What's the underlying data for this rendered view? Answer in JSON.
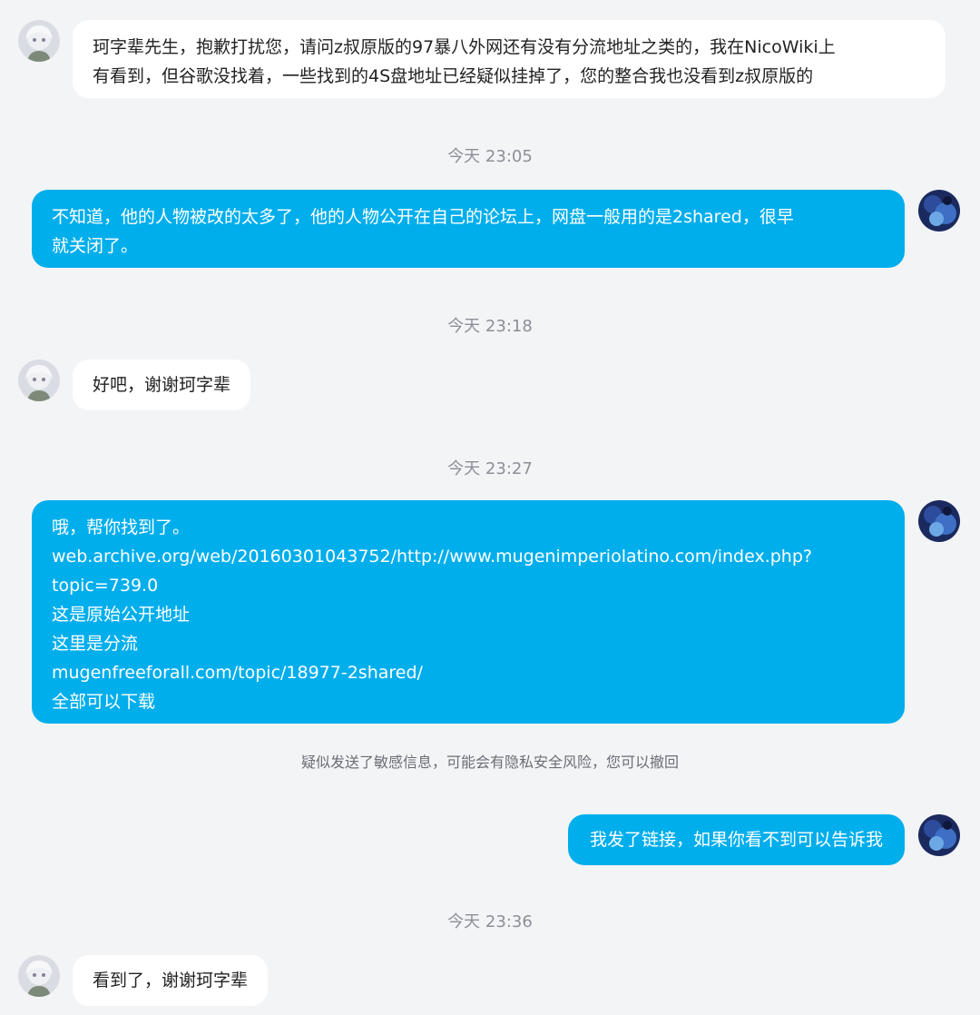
{
  "theme": {
    "background": "#f3f4f6",
    "incoming_bubble": "#ffffff",
    "outgoing_bubble": "#00aeec",
    "timestamp_color": "#8b8f96"
  },
  "messages": [
    {
      "side": "left",
      "avatar": "anime-girl-avatar-icon",
      "text": "珂字辈先生，抱歉打扰您，请问z叔原版的97暴八外网还有没有分流地址之类的，我在NicoWiki上\n有看到，但谷歌没找着，一些找到的4S盘地址已经疑似挂掉了，您的整合我也没看到z叔原版的"
    },
    {
      "timestamp": "今天 23:05"
    },
    {
      "side": "right",
      "avatar": "dark-blue-avatar-icon",
      "text": "不知道，他的人物被改的太多了，他的人物公开在自己的论坛上，网盘一般用的是2shared，很早\n就关闭了。"
    },
    {
      "timestamp": "今天 23:18"
    },
    {
      "side": "left",
      "avatar": "anime-girl-avatar-icon",
      "text": "好吧，谢谢珂字辈"
    },
    {
      "timestamp": "今天 23:27"
    },
    {
      "side": "right",
      "avatar": "dark-blue-avatar-icon",
      "text": "哦，帮你找到了。\nweb.archive.org/web/20160301043752/http://www.mugenimperiolatino.com/index.php?\ntopic=739.0\n这是原始公开地址\n这里是分流\nmugenfreeforall.com/topic/18977-2shared/\n全部可以下载"
    },
    {
      "notice": "疑似发送了敏感信息，可能会有隐私安全风险，您可以撤回"
    },
    {
      "side": "right",
      "avatar": "dark-blue-avatar-icon",
      "text": "我发了链接，如果你看不到可以告诉我"
    },
    {
      "timestamp": "今天 23:36"
    },
    {
      "side": "left",
      "avatar": "anime-girl-avatar-icon",
      "text": "看到了，谢谢珂字辈"
    }
  ]
}
